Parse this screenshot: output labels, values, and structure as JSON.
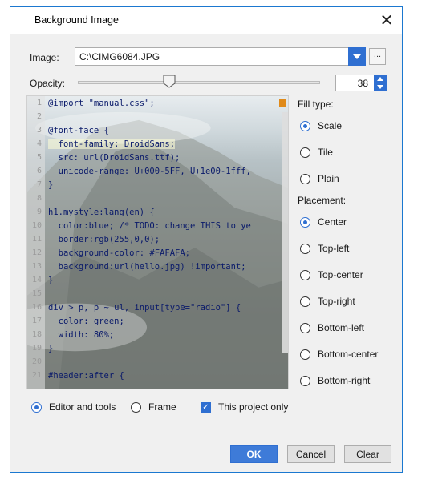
{
  "window": {
    "title": "Background Image"
  },
  "image": {
    "label": "Image:",
    "value": "C:\\CIMG6084.JPG",
    "browse_label": "..."
  },
  "opacity": {
    "label": "Opacity:",
    "value": "38",
    "slider_level_percent": 38
  },
  "fill_type": {
    "label": "Fill type:",
    "options": [
      "Scale",
      "Tile",
      "Plain"
    ],
    "selected": "Scale"
  },
  "placement": {
    "label": "Placement:",
    "options": [
      "Center",
      "Top-left",
      "Top-center",
      "Top-right",
      "Bottom-left",
      "Bottom-center",
      "Bottom-right"
    ],
    "selected": "Center"
  },
  "scope": {
    "editor_and_tools": "Editor and tools",
    "frame": "Frame",
    "project_only": "This project only",
    "selected": "Editor and tools",
    "project_only_checked": true
  },
  "buttons": {
    "ok": "OK",
    "cancel": "Cancel",
    "clear": "Clear"
  },
  "code": {
    "line_numbers": [
      "1",
      "2",
      "3",
      "4",
      "5",
      "6",
      "7",
      "8",
      "9",
      "10",
      "11",
      "12",
      "13",
      "14",
      "15",
      "16",
      "17",
      "18",
      "19",
      "20",
      "21"
    ],
    "lines": [
      "@import \"manual.css\";",
      "",
      "@font-face {",
      "  font-family: DroidSans;",
      "  src: url(DroidSans.ttf);",
      "  unicode-range: U+000-5FF, U+1e00-1fff,",
      "}",
      "",
      "h1.mystyle:lang(en) {",
      "  color:blue; /* TODO: change THIS to ye",
      "  border:rgb(255,0,0);",
      "  background-color: #FAFAFA;",
      "  background:url(hello.jpg) !important;",
      "}",
      "",
      "div > p, p ~ ul, input[type=\"radio\"] {",
      "  color: green;",
      "  width: 80%;",
      "}",
      "",
      "#header:after {"
    ]
  },
  "colors": {
    "accent": "#2f6fd1",
    "marker": "#e08a1a"
  }
}
